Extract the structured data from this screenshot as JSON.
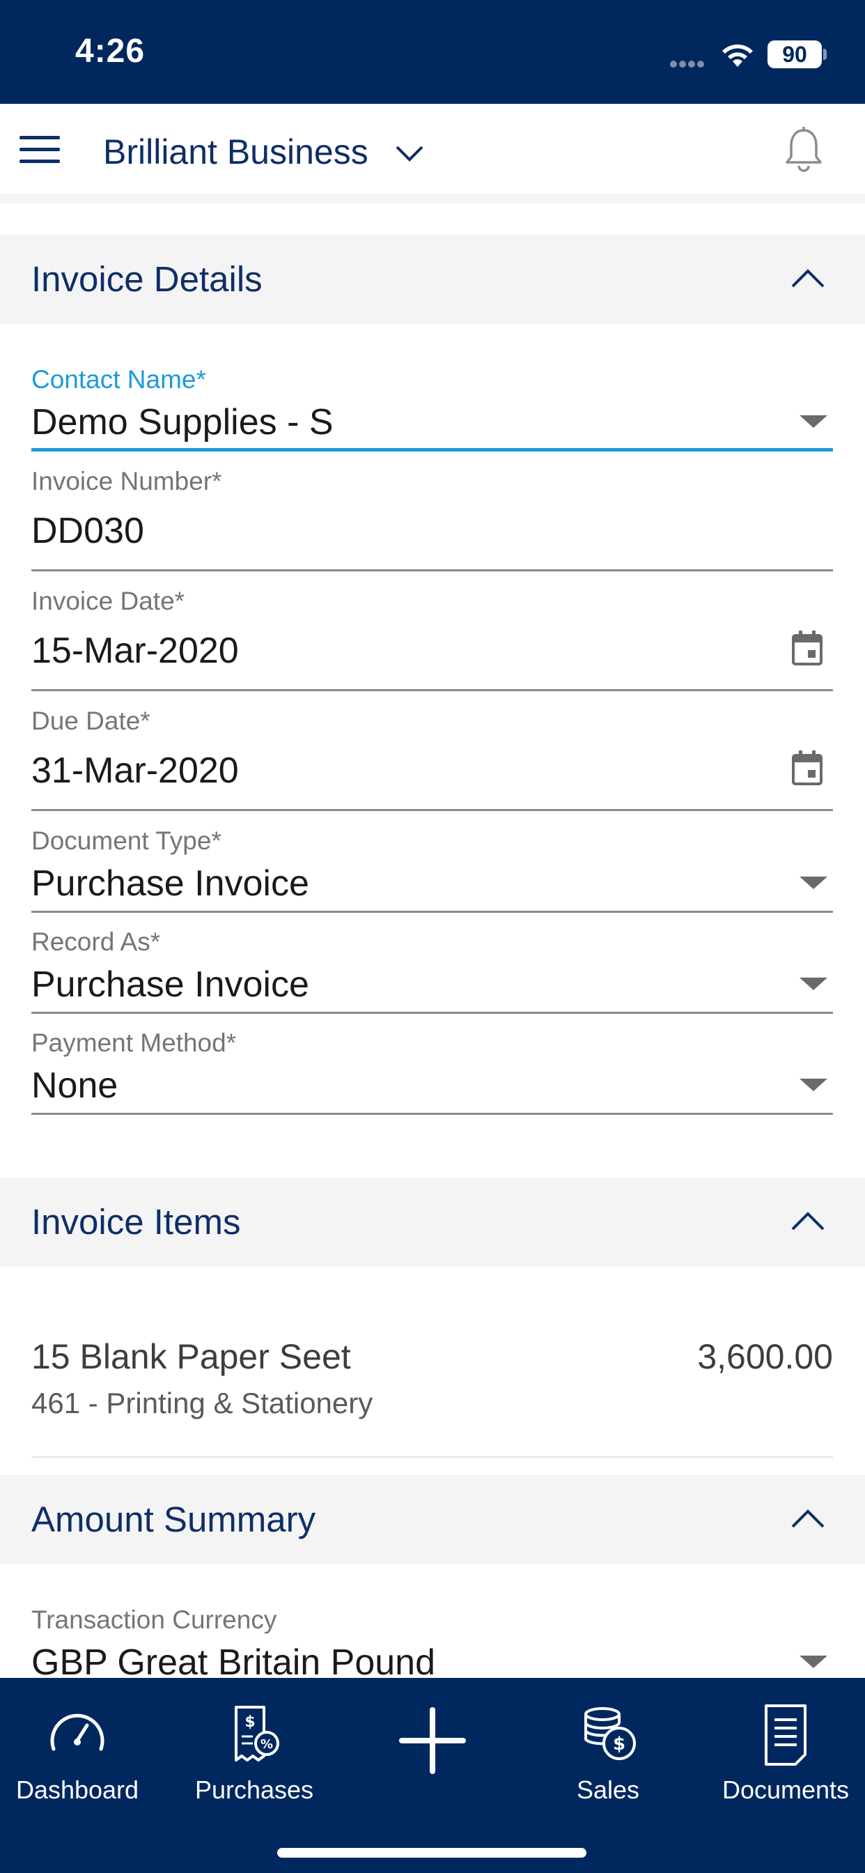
{
  "status_bar": {
    "time": "4:26",
    "battery": "90"
  },
  "header": {
    "business_name": "Brilliant Business"
  },
  "sections": {
    "invoice_details": "Invoice Details",
    "invoice_items": "Invoice Items",
    "amount_summary": "Amount Summary"
  },
  "fields": {
    "contact_name": {
      "label": "Contact Name*",
      "value": "Demo Supplies - S"
    },
    "invoice_number": {
      "label": "Invoice Number*",
      "value": "DD030"
    },
    "invoice_date": {
      "label": "Invoice Date*",
      "value": "15-Mar-2020"
    },
    "due_date": {
      "label": "Due Date*",
      "value": "31-Mar-2020"
    },
    "document_type": {
      "label": "Document Type*",
      "value": "Purchase Invoice"
    },
    "record_as": {
      "label": "Record As*",
      "value": "Purchase Invoice"
    },
    "payment_method": {
      "label": "Payment Method*",
      "value": "None"
    },
    "transaction_currency": {
      "label": "Transaction Currency",
      "value": "GBP Great Britain Pound"
    }
  },
  "invoice_items": [
    {
      "name": "15 Blank Paper Seet",
      "account": "461 - Printing & Stationery",
      "amount": "3,600.00"
    }
  ],
  "bottom_nav": {
    "dashboard": "Dashboard",
    "purchases": "Purchases",
    "sales": "Sales",
    "documents": "Documents"
  },
  "colors": {
    "navy": "#00285e",
    "accent_blue": "#1d9bd7",
    "title_blue": "#0e2e66"
  }
}
